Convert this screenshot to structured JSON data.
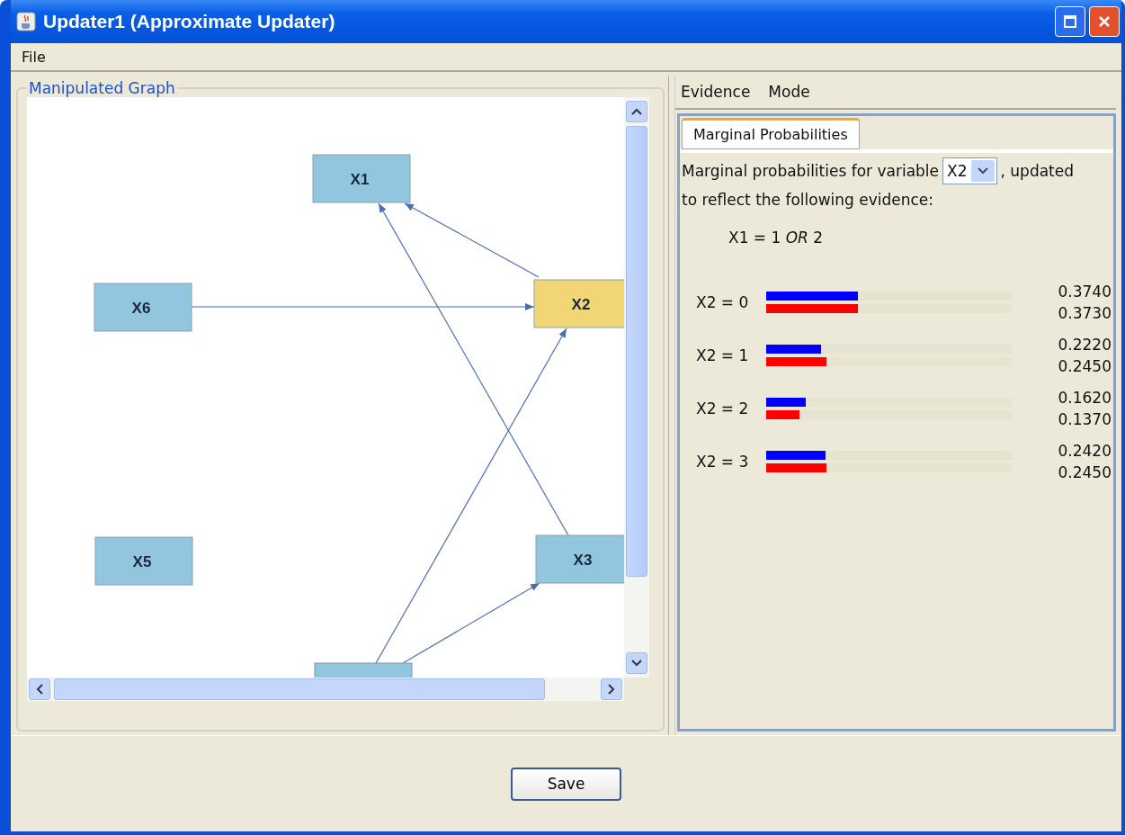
{
  "window": {
    "title": "Updater1 (Approximate Updater)"
  },
  "menu": [
    "File"
  ],
  "graph_panel": {
    "title": "Manipulated Graph",
    "nodes": [
      {
        "label": "X1",
        "selected": false
      },
      {
        "label": "X6",
        "selected": false
      },
      {
        "label": "X2",
        "selected": true
      },
      {
        "label": "X5",
        "selected": false
      },
      {
        "label": "X3",
        "selected": false
      }
    ]
  },
  "side_menu": [
    "Evidence",
    "Mode"
  ],
  "tabs": [
    {
      "label": "Marginal Probabilities",
      "selected": true
    }
  ],
  "intro": "Marginal probabilities for variable",
  "variable_select": {
    "value": "X2"
  },
  "intro_rest": [
    ", updated",
    "to reflect the following evidence:"
  ],
  "evidence": "X1 = 1 *OR* 2",
  "rows": [
    {
      "label": "X2 = 0",
      "bars": [
        {
          "level": 0.374,
          "color": "#0000ff",
          "reading": "0.3740"
        },
        {
          "level": 0.373,
          "color": "#ff0000",
          "reading": "0.3730"
        }
      ]
    },
    {
      "label": "X2 = 1",
      "bars": [
        {
          "level": 0.222,
          "color": "#0000ff",
          "reading": "0.2220"
        },
        {
          "level": 0.245,
          "color": "#ff0000",
          "reading": "0.2450"
        }
      ]
    },
    {
      "label": "X2 = 2",
      "bars": [
        {
          "level": 0.162,
          "color": "#0000ff",
          "reading": "0.1620"
        },
        {
          "level": 0.137,
          "color": "#ff0000",
          "reading": "0.1370"
        }
      ]
    },
    {
      "label": "X2 = 3",
      "bars": [
        {
          "level": 0.242,
          "color": "#0000ff",
          "reading": "0.2420"
        },
        {
          "level": 0.245,
          "color": "#ff0000",
          "reading": "0.2450"
        }
      ]
    }
  ],
  "buttons": [
    "Save"
  ]
}
